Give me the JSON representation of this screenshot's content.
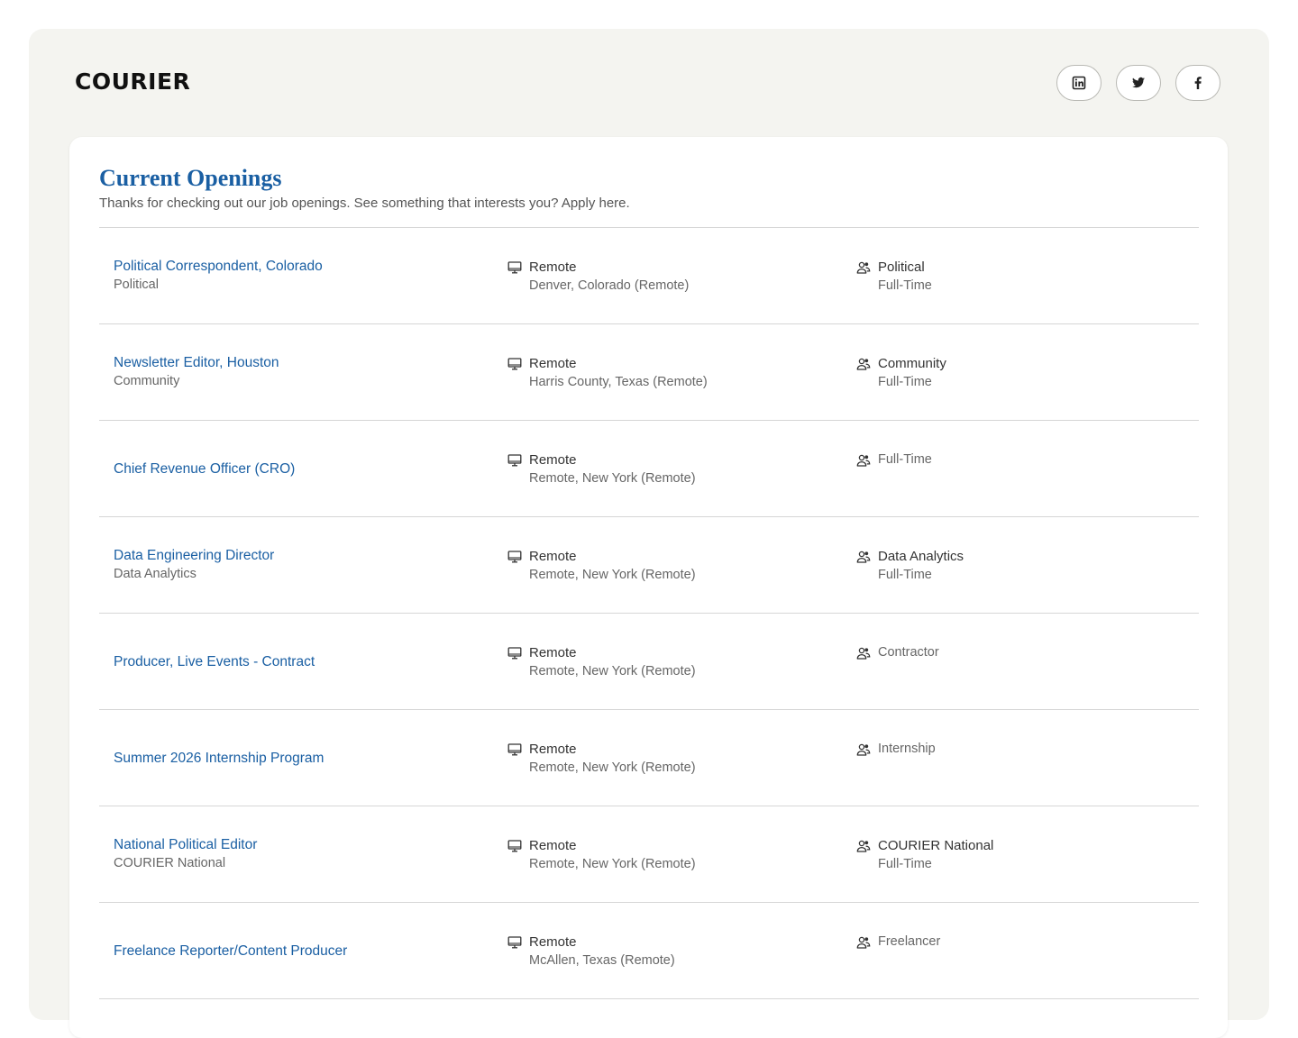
{
  "header": {
    "logo_text": "COURIER",
    "social": [
      {
        "name": "linkedin-icon"
      },
      {
        "name": "twitter-icon"
      },
      {
        "name": "facebook-icon"
      }
    ]
  },
  "openings": {
    "title": "Current Openings",
    "subtitle": "Thanks for checking out our job openings. See something that interests you? Apply here.",
    "jobs": [
      {
        "title": "Political Correspondent, Colorado",
        "department": "Political",
        "workplace": "Remote",
        "location": "Denver, Colorado (Remote)",
        "team": "Political",
        "employment": "Full-Time"
      },
      {
        "title": "Newsletter Editor, Houston",
        "department": "Community",
        "workplace": "Remote",
        "location": "Harris County, Texas (Remote)",
        "team": "Community",
        "employment": "Full-Time"
      },
      {
        "title": "Chief Revenue Officer (CRO)",
        "department": "",
        "workplace": "Remote",
        "location": "Remote, New York (Remote)",
        "team": "",
        "employment": "Full-Time"
      },
      {
        "title": "Data Engineering Director",
        "department": "Data Analytics",
        "workplace": "Remote",
        "location": "Remote, New York (Remote)",
        "team": "Data Analytics",
        "employment": "Full-Time"
      },
      {
        "title": "Producer, Live Events - Contract",
        "department": "",
        "workplace": "Remote",
        "location": "Remote, New York (Remote)",
        "team": "",
        "employment": "Contractor"
      },
      {
        "title": "Summer 2026 Internship Program",
        "department": "",
        "workplace": "Remote",
        "location": "Remote, New York (Remote)",
        "team": "",
        "employment": "Internship"
      },
      {
        "title": "National Political Editor",
        "department": "COURIER National",
        "workplace": "Remote",
        "location": "Remote, New York (Remote)",
        "team": "COURIER National",
        "employment": "Full-Time"
      },
      {
        "title": "Freelance Reporter/Content Producer",
        "department": "",
        "workplace": "Remote",
        "location": "McAllen, Texas (Remote)",
        "team": "",
        "employment": "Freelancer"
      }
    ]
  },
  "colors": {
    "link": "#1a5fa3",
    "background": "#f4f4f0"
  }
}
